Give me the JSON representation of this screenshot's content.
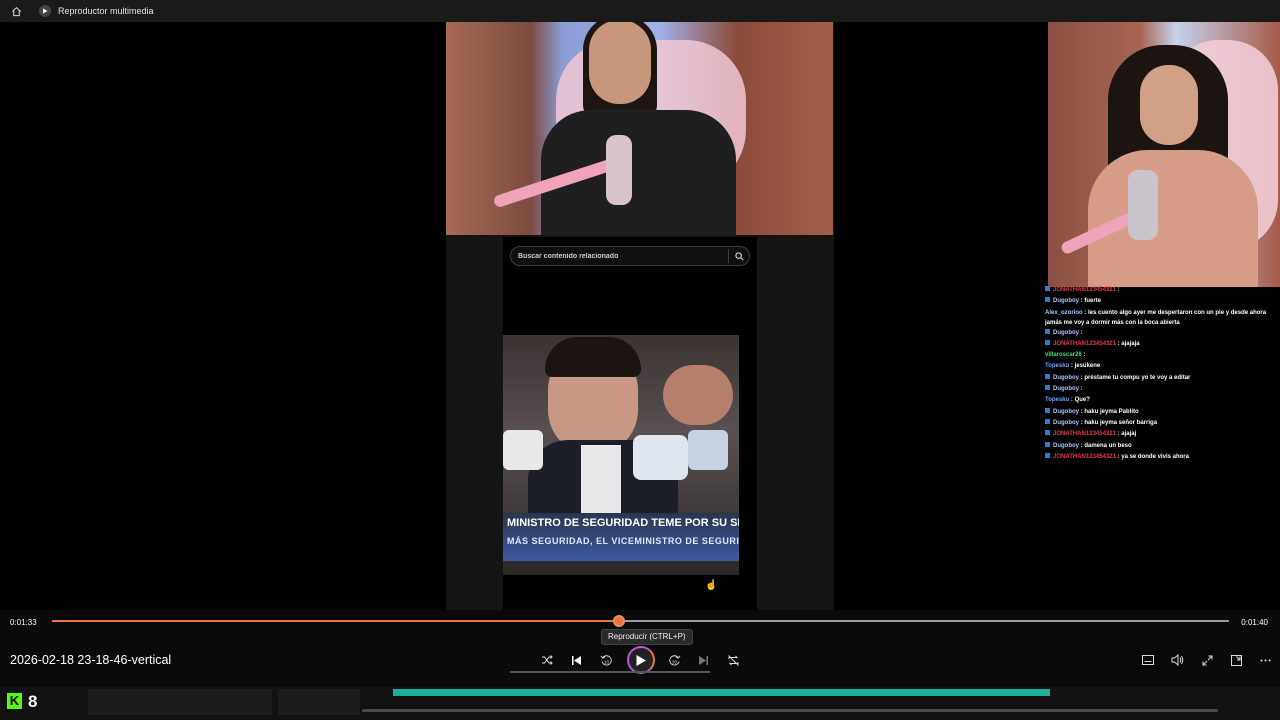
{
  "window": {
    "title": "Reproductor multimedia",
    "home_icon": "home-icon",
    "app_icon": "media-player-icon"
  },
  "overlay": {
    "search_placeholder": "Buscar contenido relacionado",
    "search_icon": "search-icon",
    "news_ticker_line1": "MINISTRO DE SEGURIDAD TEME POR SU SEGURI",
    "news_ticker_line2": "MÁS SEGURIDAD, EL VICEMINISTRO DE SEGURID"
  },
  "chat": {
    "colors": {
      "badge": "#2d7bd6"
    },
    "messages": [
      {
        "user": "JONATHAN123454321",
        "text": ": ",
        "color": "#e0394f",
        "badge": true
      },
      {
        "user": "Dugoboy",
        "text": ": fuerte",
        "color": "#a9c6ff",
        "badge": true
      },
      {
        "user": "Alex_ozorioo",
        "text": ": les cuento algo ayer me despertaron con un pie y desde ahora jamás me voy a dormir más con la boca abierta",
        "color": "#a9c6ff",
        "badge": false,
        "wrap": true
      },
      {
        "user": "Dugoboy",
        "text": ": ",
        "color": "#a9c6ff",
        "badge": true
      },
      {
        "user": "JONATHAN123454321",
        "text": ": ajajaja",
        "color": "#e0394f",
        "badge": true
      },
      {
        "user": "villaroscar26",
        "text": ": ",
        "color": "#3ce07a",
        "badge": false
      },
      {
        "user": "Topesku",
        "text": ": jesúkene",
        "color": "#6ea3ff",
        "badge": false
      },
      {
        "user": "Dugoboy",
        "text": ": préstame tu compu yo te voy a editar",
        "color": "#a9c6ff",
        "badge": true
      },
      {
        "user": "Dugoboy",
        "text": ": ",
        "color": "#a9c6ff",
        "badge": true
      },
      {
        "user": "Topesku",
        "text": ": Que?",
        "color": "#6ea3ff",
        "badge": false
      },
      {
        "user": "Dugoboy",
        "text": ": haku jeyma Pablito",
        "color": "#a9c6ff",
        "badge": true
      },
      {
        "user": "Dugoboy",
        "text": ": haku jeyma señor barriga",
        "color": "#a9c6ff",
        "badge": true
      },
      {
        "user": "JONATHAN123454321",
        "text": ": ajajaj",
        "color": "#e0394f",
        "badge": true
      },
      {
        "user": "Dugoboy",
        "text": ": damena un beso",
        "color": "#a9c6ff",
        "badge": true
      },
      {
        "user": "JONATHAN123454321",
        "text": ": ya se donde vivis ahora",
        "color": "#e0394f",
        "badge": true
      }
    ]
  },
  "player": {
    "current_time": "0:01:33",
    "total_time": "0:01:40",
    "progress": 0.482,
    "tooltip": "Reproducir (CTRL+P)",
    "file_title": "2026-02-18 23-18-46-vertical",
    "skip_back_label": "10",
    "skip_forward_label": "30",
    "accent_color": "#e9743e",
    "buttons": {
      "shuffle": "shuffle-icon",
      "previous": "previous-icon",
      "rewind": "rewind-10-icon",
      "play": "play-icon",
      "forward": "forward-30-icon",
      "next": "next-icon",
      "repeat": "repeat-off-icon",
      "subtitles": "subtitles-icon",
      "volume": "volume-icon",
      "fullscreen": "fullscreen-icon",
      "miniplayer": "miniplayer-icon",
      "more": "more-icon"
    }
  },
  "taskbar": {
    "kick_logo": "K",
    "kick_count": "8",
    "kick_color": "#53fc18"
  }
}
